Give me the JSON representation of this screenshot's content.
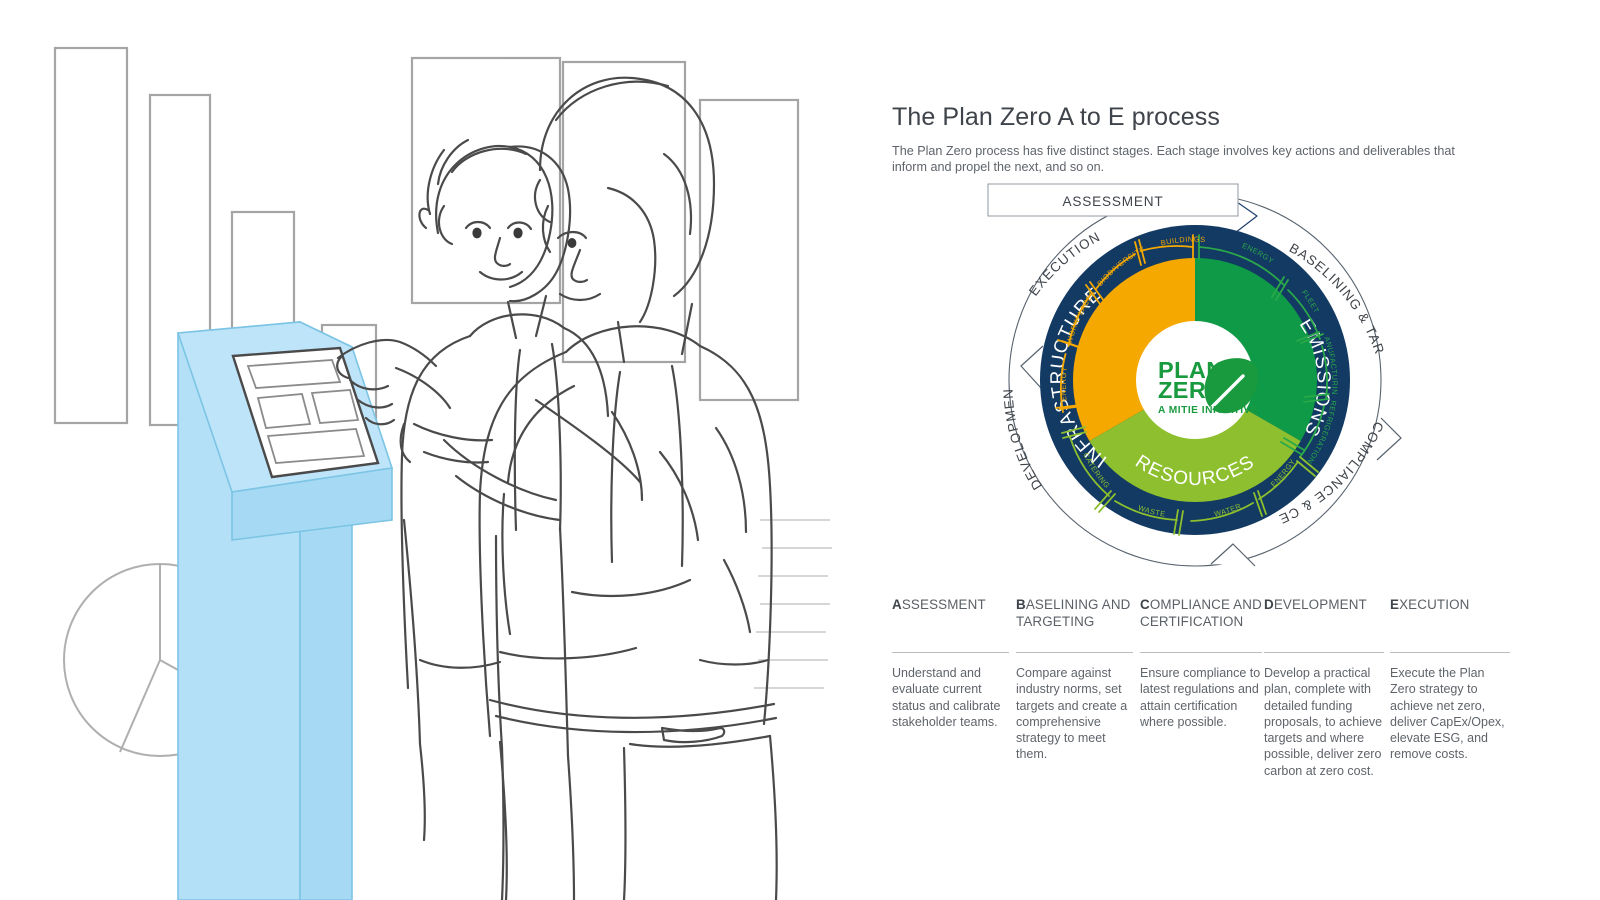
{
  "header": {
    "title": "The Plan Zero A to E process",
    "intro": "The Plan Zero process has five distinct stages. Each stage involves key actions and deliverables that inform and propel the next, and so on."
  },
  "illustration": {
    "alt": "Pencil sketch of two colleagues using a touchscreen kiosk",
    "kiosk_color": "#b3e0f7",
    "line_color": "#4a4a4a"
  },
  "diagram": {
    "type": "concentric-process-wheel",
    "center_logo": {
      "line1": "PLAN",
      "line2": "ZERO",
      "line3": "A MITIE INITIATIVE",
      "leaf_color": "#1a9a3f",
      "text_color": "#1a9a3f"
    },
    "outer_stages": [
      {
        "label": "ASSESSMENT",
        "style": "boxed"
      },
      {
        "label": "BASELINING & TARGETING",
        "style": "arc"
      },
      {
        "label": "COMPLIANCE & CERTIFICATION",
        "style": "arc"
      },
      {
        "label": "DEVELOPMENT",
        "style": "arc"
      },
      {
        "label": "EXECUTION",
        "style": "arc"
      }
    ],
    "outer_ring_color": "#2c4a7c",
    "navy_ring_color": "#123a63",
    "segments": [
      {
        "name": "INFRASTRUCTURE",
        "color": "#f5a800",
        "tick_color": "#f5a800",
        "items": [
          "BUILDINGS",
          "BIODIVERSITY",
          "WORKPLACES",
          "ENERGY"
        ]
      },
      {
        "name": "EMISSIONS",
        "color": "#0e9a46",
        "tick_color": "#2aa84a",
        "items": [
          "ENERGY",
          "FLEET",
          "MANUFACTURING",
          "REFRIGERATION"
        ]
      },
      {
        "name": "RESOURCES",
        "color": "#8dbf2e",
        "tick_color": "#8dbf2e",
        "items": [
          "ENERGY",
          "WATER",
          "WASTE",
          "CATERING"
        ]
      }
    ]
  },
  "columns": [
    {
      "initial": "A",
      "rest": "SSESSMENT",
      "body": "Understand and evaluate current status and calibrate stakeholder teams."
    },
    {
      "initial": "B",
      "rest": "ASELINING AND TARGETING",
      "body": "Compare against industry norms, set targets and create a comprehensive strategy to meet them."
    },
    {
      "initial": "C",
      "rest": "OMPLIANCE AND CERTIFICATION",
      "body": "Ensure compliance to latest regulations and attain certification where possible."
    },
    {
      "initial": "D",
      "rest": "EVELOPMENT",
      "body": "Develop a practical plan, complete with detailed funding proposals, to achieve targets and where possible, deliver zero carbon at zero cost."
    },
    {
      "initial": "E",
      "rest": "XECUTION",
      "body": "Execute the Plan Zero strategy to achieve net zero, deliver CapEx/Opex, elevate ESG, and remove costs."
    }
  ]
}
